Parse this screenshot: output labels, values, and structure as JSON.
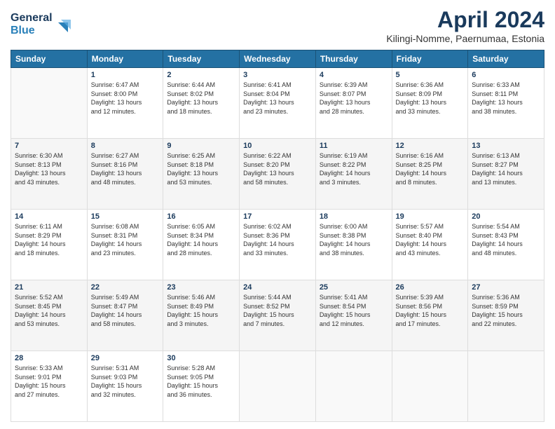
{
  "header": {
    "logo_line1": "General",
    "logo_line2": "Blue",
    "title": "April 2024",
    "location": "Kilingi-Nomme, Paernumaa, Estonia"
  },
  "days_of_week": [
    "Sunday",
    "Monday",
    "Tuesday",
    "Wednesday",
    "Thursday",
    "Friday",
    "Saturday"
  ],
  "weeks": [
    [
      {
        "day": "",
        "info": ""
      },
      {
        "day": "1",
        "info": "Sunrise: 6:47 AM\nSunset: 8:00 PM\nDaylight: 13 hours\nand 12 minutes."
      },
      {
        "day": "2",
        "info": "Sunrise: 6:44 AM\nSunset: 8:02 PM\nDaylight: 13 hours\nand 18 minutes."
      },
      {
        "day": "3",
        "info": "Sunrise: 6:41 AM\nSunset: 8:04 PM\nDaylight: 13 hours\nand 23 minutes."
      },
      {
        "day": "4",
        "info": "Sunrise: 6:39 AM\nSunset: 8:07 PM\nDaylight: 13 hours\nand 28 minutes."
      },
      {
        "day": "5",
        "info": "Sunrise: 6:36 AM\nSunset: 8:09 PM\nDaylight: 13 hours\nand 33 minutes."
      },
      {
        "day": "6",
        "info": "Sunrise: 6:33 AM\nSunset: 8:11 PM\nDaylight: 13 hours\nand 38 minutes."
      }
    ],
    [
      {
        "day": "7",
        "info": "Sunrise: 6:30 AM\nSunset: 8:13 PM\nDaylight: 13 hours\nand 43 minutes."
      },
      {
        "day": "8",
        "info": "Sunrise: 6:27 AM\nSunset: 8:16 PM\nDaylight: 13 hours\nand 48 minutes."
      },
      {
        "day": "9",
        "info": "Sunrise: 6:25 AM\nSunset: 8:18 PM\nDaylight: 13 hours\nand 53 minutes."
      },
      {
        "day": "10",
        "info": "Sunrise: 6:22 AM\nSunset: 8:20 PM\nDaylight: 13 hours\nand 58 minutes."
      },
      {
        "day": "11",
        "info": "Sunrise: 6:19 AM\nSunset: 8:22 PM\nDaylight: 14 hours\nand 3 minutes."
      },
      {
        "day": "12",
        "info": "Sunrise: 6:16 AM\nSunset: 8:25 PM\nDaylight: 14 hours\nand 8 minutes."
      },
      {
        "day": "13",
        "info": "Sunrise: 6:13 AM\nSunset: 8:27 PM\nDaylight: 14 hours\nand 13 minutes."
      }
    ],
    [
      {
        "day": "14",
        "info": "Sunrise: 6:11 AM\nSunset: 8:29 PM\nDaylight: 14 hours\nand 18 minutes."
      },
      {
        "day": "15",
        "info": "Sunrise: 6:08 AM\nSunset: 8:31 PM\nDaylight: 14 hours\nand 23 minutes."
      },
      {
        "day": "16",
        "info": "Sunrise: 6:05 AM\nSunset: 8:34 PM\nDaylight: 14 hours\nand 28 minutes."
      },
      {
        "day": "17",
        "info": "Sunrise: 6:02 AM\nSunset: 8:36 PM\nDaylight: 14 hours\nand 33 minutes."
      },
      {
        "day": "18",
        "info": "Sunrise: 6:00 AM\nSunset: 8:38 PM\nDaylight: 14 hours\nand 38 minutes."
      },
      {
        "day": "19",
        "info": "Sunrise: 5:57 AM\nSunset: 8:40 PM\nDaylight: 14 hours\nand 43 minutes."
      },
      {
        "day": "20",
        "info": "Sunrise: 5:54 AM\nSunset: 8:43 PM\nDaylight: 14 hours\nand 48 minutes."
      }
    ],
    [
      {
        "day": "21",
        "info": "Sunrise: 5:52 AM\nSunset: 8:45 PM\nDaylight: 14 hours\nand 53 minutes."
      },
      {
        "day": "22",
        "info": "Sunrise: 5:49 AM\nSunset: 8:47 PM\nDaylight: 14 hours\nand 58 minutes."
      },
      {
        "day": "23",
        "info": "Sunrise: 5:46 AM\nSunset: 8:49 PM\nDaylight: 15 hours\nand 3 minutes."
      },
      {
        "day": "24",
        "info": "Sunrise: 5:44 AM\nSunset: 8:52 PM\nDaylight: 15 hours\nand 7 minutes."
      },
      {
        "day": "25",
        "info": "Sunrise: 5:41 AM\nSunset: 8:54 PM\nDaylight: 15 hours\nand 12 minutes."
      },
      {
        "day": "26",
        "info": "Sunrise: 5:39 AM\nSunset: 8:56 PM\nDaylight: 15 hours\nand 17 minutes."
      },
      {
        "day": "27",
        "info": "Sunrise: 5:36 AM\nSunset: 8:59 PM\nDaylight: 15 hours\nand 22 minutes."
      }
    ],
    [
      {
        "day": "28",
        "info": "Sunrise: 5:33 AM\nSunset: 9:01 PM\nDaylight: 15 hours\nand 27 minutes."
      },
      {
        "day": "29",
        "info": "Sunrise: 5:31 AM\nSunset: 9:03 PM\nDaylight: 15 hours\nand 32 minutes."
      },
      {
        "day": "30",
        "info": "Sunrise: 5:28 AM\nSunset: 9:05 PM\nDaylight: 15 hours\nand 36 minutes."
      },
      {
        "day": "",
        "info": ""
      },
      {
        "day": "",
        "info": ""
      },
      {
        "day": "",
        "info": ""
      },
      {
        "day": "",
        "info": ""
      }
    ]
  ]
}
